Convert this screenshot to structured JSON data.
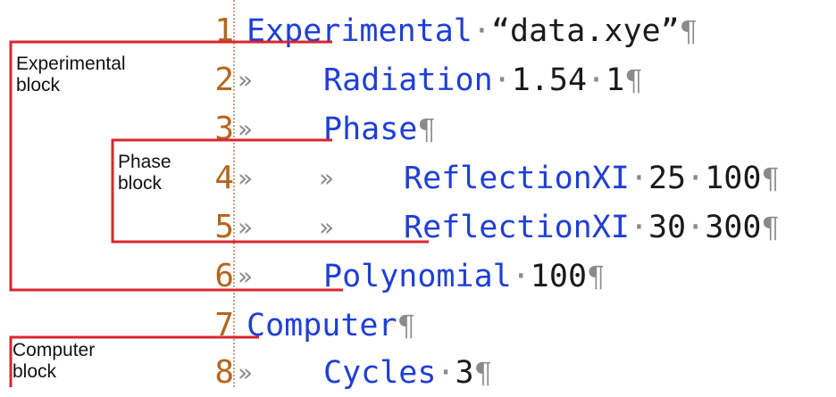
{
  "lines": [
    {
      "num": "1",
      "tabs": 0,
      "keyword": "Experimental",
      "args": [
        {
          "sep": "·",
          "val": "“data.xye”"
        }
      ]
    },
    {
      "num": "2",
      "tabs": 1,
      "keyword": "Radiation",
      "args": [
        {
          "sep": "·",
          "val": "1.54"
        },
        {
          "sep": "·",
          "val": "1"
        }
      ]
    },
    {
      "num": "3",
      "tabs": 1,
      "keyword": "Phase",
      "args": []
    },
    {
      "num": "4",
      "tabs": 2,
      "keyword": "ReflectionXI",
      "args": [
        {
          "sep": "·",
          "val": "25"
        },
        {
          "sep": "·",
          "val": "100"
        }
      ]
    },
    {
      "num": "5",
      "tabs": 2,
      "keyword": "ReflectionXI",
      "args": [
        {
          "sep": "·",
          "val": "30"
        },
        {
          "sep": "·",
          "val": "300"
        }
      ]
    },
    {
      "num": "6",
      "tabs": 1,
      "keyword": "Polynomial",
      "args": [
        {
          "sep": "·",
          "val": "100"
        }
      ]
    },
    {
      "num": "7",
      "tabs": 0,
      "keyword": "Computer",
      "args": []
    },
    {
      "num": "8",
      "tabs": 1,
      "keyword": "Cycles",
      "args": [
        {
          "sep": "·",
          "val": "3"
        }
      ]
    }
  ],
  "tab_glyph": "»",
  "pilcrow": "¶",
  "labels": {
    "experimental_block": [
      "Experimental",
      "block"
    ],
    "phase_block": [
      "Phase",
      "block"
    ],
    "computer_block": [
      "Computer",
      "block"
    ]
  },
  "colors": {
    "keyword": "#1f3fd6",
    "line_number": "#b5651d",
    "bracket": "#d9262e",
    "whitespace_marks": "#8a8a8a"
  }
}
